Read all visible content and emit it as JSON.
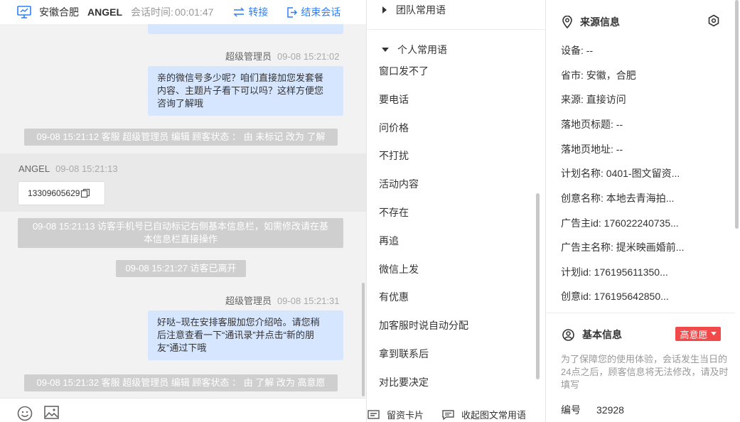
{
  "header": {
    "location": "安徽合肥",
    "visitor": "ANGEL",
    "timer_label": "会话时间:",
    "timer": "00:01:47",
    "transfer_label": "转接",
    "end_label": "结束会话"
  },
  "messages": {
    "m1_sender": "超级管理员",
    "m1_time": "09-08 15:21:02",
    "m1_line1": "亲的微信号多少呢？咱们直接加您发套餐",
    "m1_line2": "内容、主题片子看下可以吗？这样方便您",
    "m1_line3": "咨询了解哦",
    "sys1": "09-08 15:21:12 客服 超级管理员 编辑 顾客状态 ： 由 未标记 改为 了解",
    "v_sender": "ANGEL",
    "v_time": "09-08 15:21:13",
    "v_phone": "13309605629",
    "sys2_line1": "09-08 15:21:13 访客手机号已自动标记右侧基本信息栏，如需修改请在基",
    "sys2_line2": "本信息栏直接操作",
    "sys3": "09-08 15:21:27 访客已离开",
    "m2_sender": "超级管理员",
    "m2_time": "09-08 15:21:31",
    "m2_line1": "好哒~现在安排客服加您介绍哈。请您稍",
    "m2_line2": "后注意查看一下“通讯录”并点击“新的朋",
    "m2_line3": "友”通过下哦",
    "sys4": "09-08 15:21:32 客服 超级管理员 编辑 顾客状态 ： 由 了解 改为 高意愿"
  },
  "phrases": {
    "team_title": "团队常用语",
    "personal_title": "个人常用语",
    "items": [
      "窗口发不了",
      "要电话",
      "问价格",
      "不打扰",
      "活动内容",
      "不存在",
      "再追",
      "微信上发",
      "有优惠",
      "加客服时说自动分配",
      "拿到联系后",
      "对比要决定"
    ],
    "card_label": "留资卡片",
    "collapse_label": "收起图文常用语"
  },
  "info": {
    "source_title": "来源信息",
    "rows": [
      "设备: --",
      "省市: 安徽，合肥",
      "来源: 直接访问",
      "落地页标题: --",
      "落地页地址: --",
      "计划名称: 0401-图文留资...",
      "创意名称: 本地去青海拍...",
      "广告主id: 176022240735...",
      "广告主名称: 提米映画婚前...",
      "计划id: 176195611350...",
      "创意id: 176195642850..."
    ],
    "basic_title": "基本信息",
    "intent_badge": "高意愿",
    "notice": "为了保障您的使用体验，会话发生当日的24点之后，顾客信息将无法修改，请及时填写",
    "number_label": "编号",
    "number_value": "32928"
  },
  "colors": {
    "accent": "#2d7ef7",
    "bubble": "#d6e6ff",
    "badge": "#f04a4a"
  }
}
